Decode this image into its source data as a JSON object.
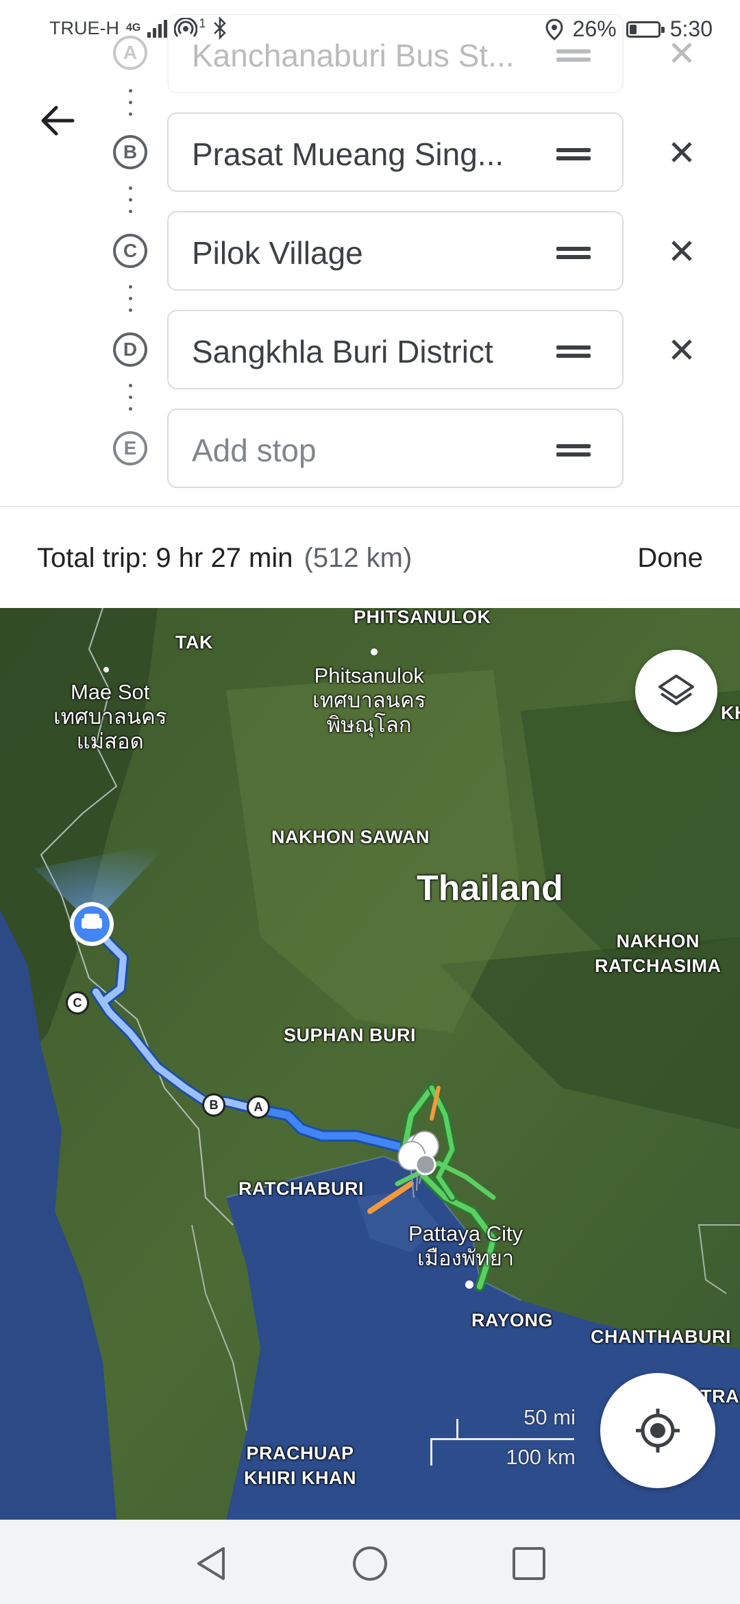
{
  "status_bar": {
    "carrier": "TRUE-H",
    "network": "4G",
    "hotspot_badge": "1",
    "battery_percent": "26%",
    "battery_level": 0.26,
    "time": "5:30"
  },
  "stops": [
    {
      "letter": "A",
      "value": "Kanchanaburi Bus St..."
    },
    {
      "letter": "B",
      "value": "Prasat Mueang Sing..."
    },
    {
      "letter": "C",
      "value": "Pilok Village"
    },
    {
      "letter": "D",
      "value": "Sangkhla Buri District"
    },
    {
      "letter": "E",
      "placeholder": "Add stop"
    }
  ],
  "trip": {
    "summary": "Total trip: 9 hr 27 min",
    "distance": "(512 km)",
    "done_label": "Done"
  },
  "map": {
    "labels": {
      "phitsanulok_region": "PHITSANULOK",
      "tak": "TAK",
      "mae_sot": "Mae Sot",
      "mae_sot_thai_1": "เทศบาลนคร",
      "mae_sot_thai_2": "แม่สอด",
      "phitsanulok_city": "Phitsanulok",
      "phitsanulok_thai_1": "เทศบาลนคร",
      "phitsanulok_thai_2": "พิษณุโลก",
      "nakhon_sawan": "NAKHON SAWAN",
      "thailand": "Thailand",
      "nakhon_ratchasima_1": "NAKHON",
      "nakhon_ratchasima_2": "RATCHASIMA",
      "suphan_buri": "SUPHAN BURI",
      "ratchaburi": "RATCHABURI",
      "pattaya": "Pattaya City",
      "pattaya_thai": "เมืองพัทยา",
      "rayong": "RAYONG",
      "chanthaburi": "CHANTHABURI",
      "prachuap_1": "PRACHUAP",
      "prachuap_2": "KHIRI KHAN",
      "edge_kh": "KH",
      "edge_tra": "TRA"
    },
    "markers": {
      "a": "A",
      "b": "B",
      "c": "C"
    },
    "scale": {
      "miles": "50 mi",
      "km": "100 km"
    },
    "colors": {
      "route": "#7aa9f7",
      "route_active": "#4285f4",
      "traffic_green": "#34a853",
      "traffic_orange": "#f29a3b"
    }
  },
  "icons": {
    "back": "arrow-left-icon",
    "remove": "close-icon",
    "drag": "drag-handle-icon",
    "layers": "layers-icon",
    "locate": "my-location-icon",
    "car": "car-icon"
  }
}
